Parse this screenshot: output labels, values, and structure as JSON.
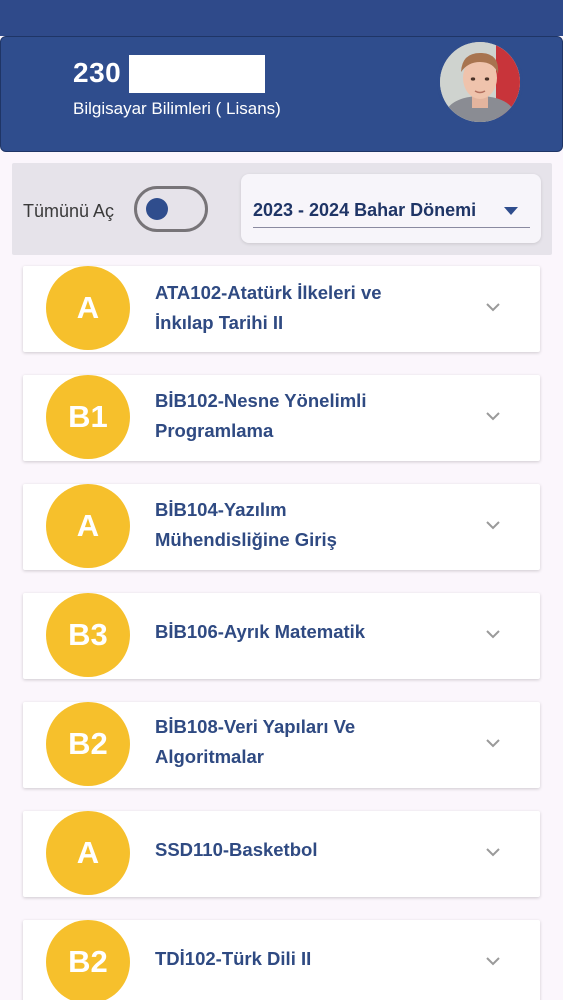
{
  "header": {
    "student_id": "230",
    "department": "Bilgisayar Bilimleri ( Lisans)"
  },
  "filter": {
    "toggle_label": "Tümünü Aç",
    "toggle_on": false,
    "term": "2023 - 2024 Bahar Dönemi"
  },
  "colors": {
    "primary": "#2f4d8d",
    "grade_badge": "#f6c02c",
    "course_text": "#2f4a82"
  },
  "courses": [
    {
      "grade": "A",
      "name": "ATA102-Atatürk İlkeleri ve İnkılap Tarihi II"
    },
    {
      "grade": "B1",
      "name": "BİB102-Nesne Yönelimli Programlama"
    },
    {
      "grade": "A",
      "name": "BİB104-Yazılım Mühendisliğine Giriş"
    },
    {
      "grade": "B3",
      "name": "BİB106-Ayrık Matematik"
    },
    {
      "grade": "B2",
      "name": "BİB108-Veri Yapıları Ve Algoritmalar"
    },
    {
      "grade": "A",
      "name": "SSD110-Basketbol"
    },
    {
      "grade": "B2",
      "name": "TDİ102-Türk Dili II"
    }
  ],
  "icons": {
    "expand": "chevron-down-icon",
    "dropdown": "caret-down-icon"
  }
}
